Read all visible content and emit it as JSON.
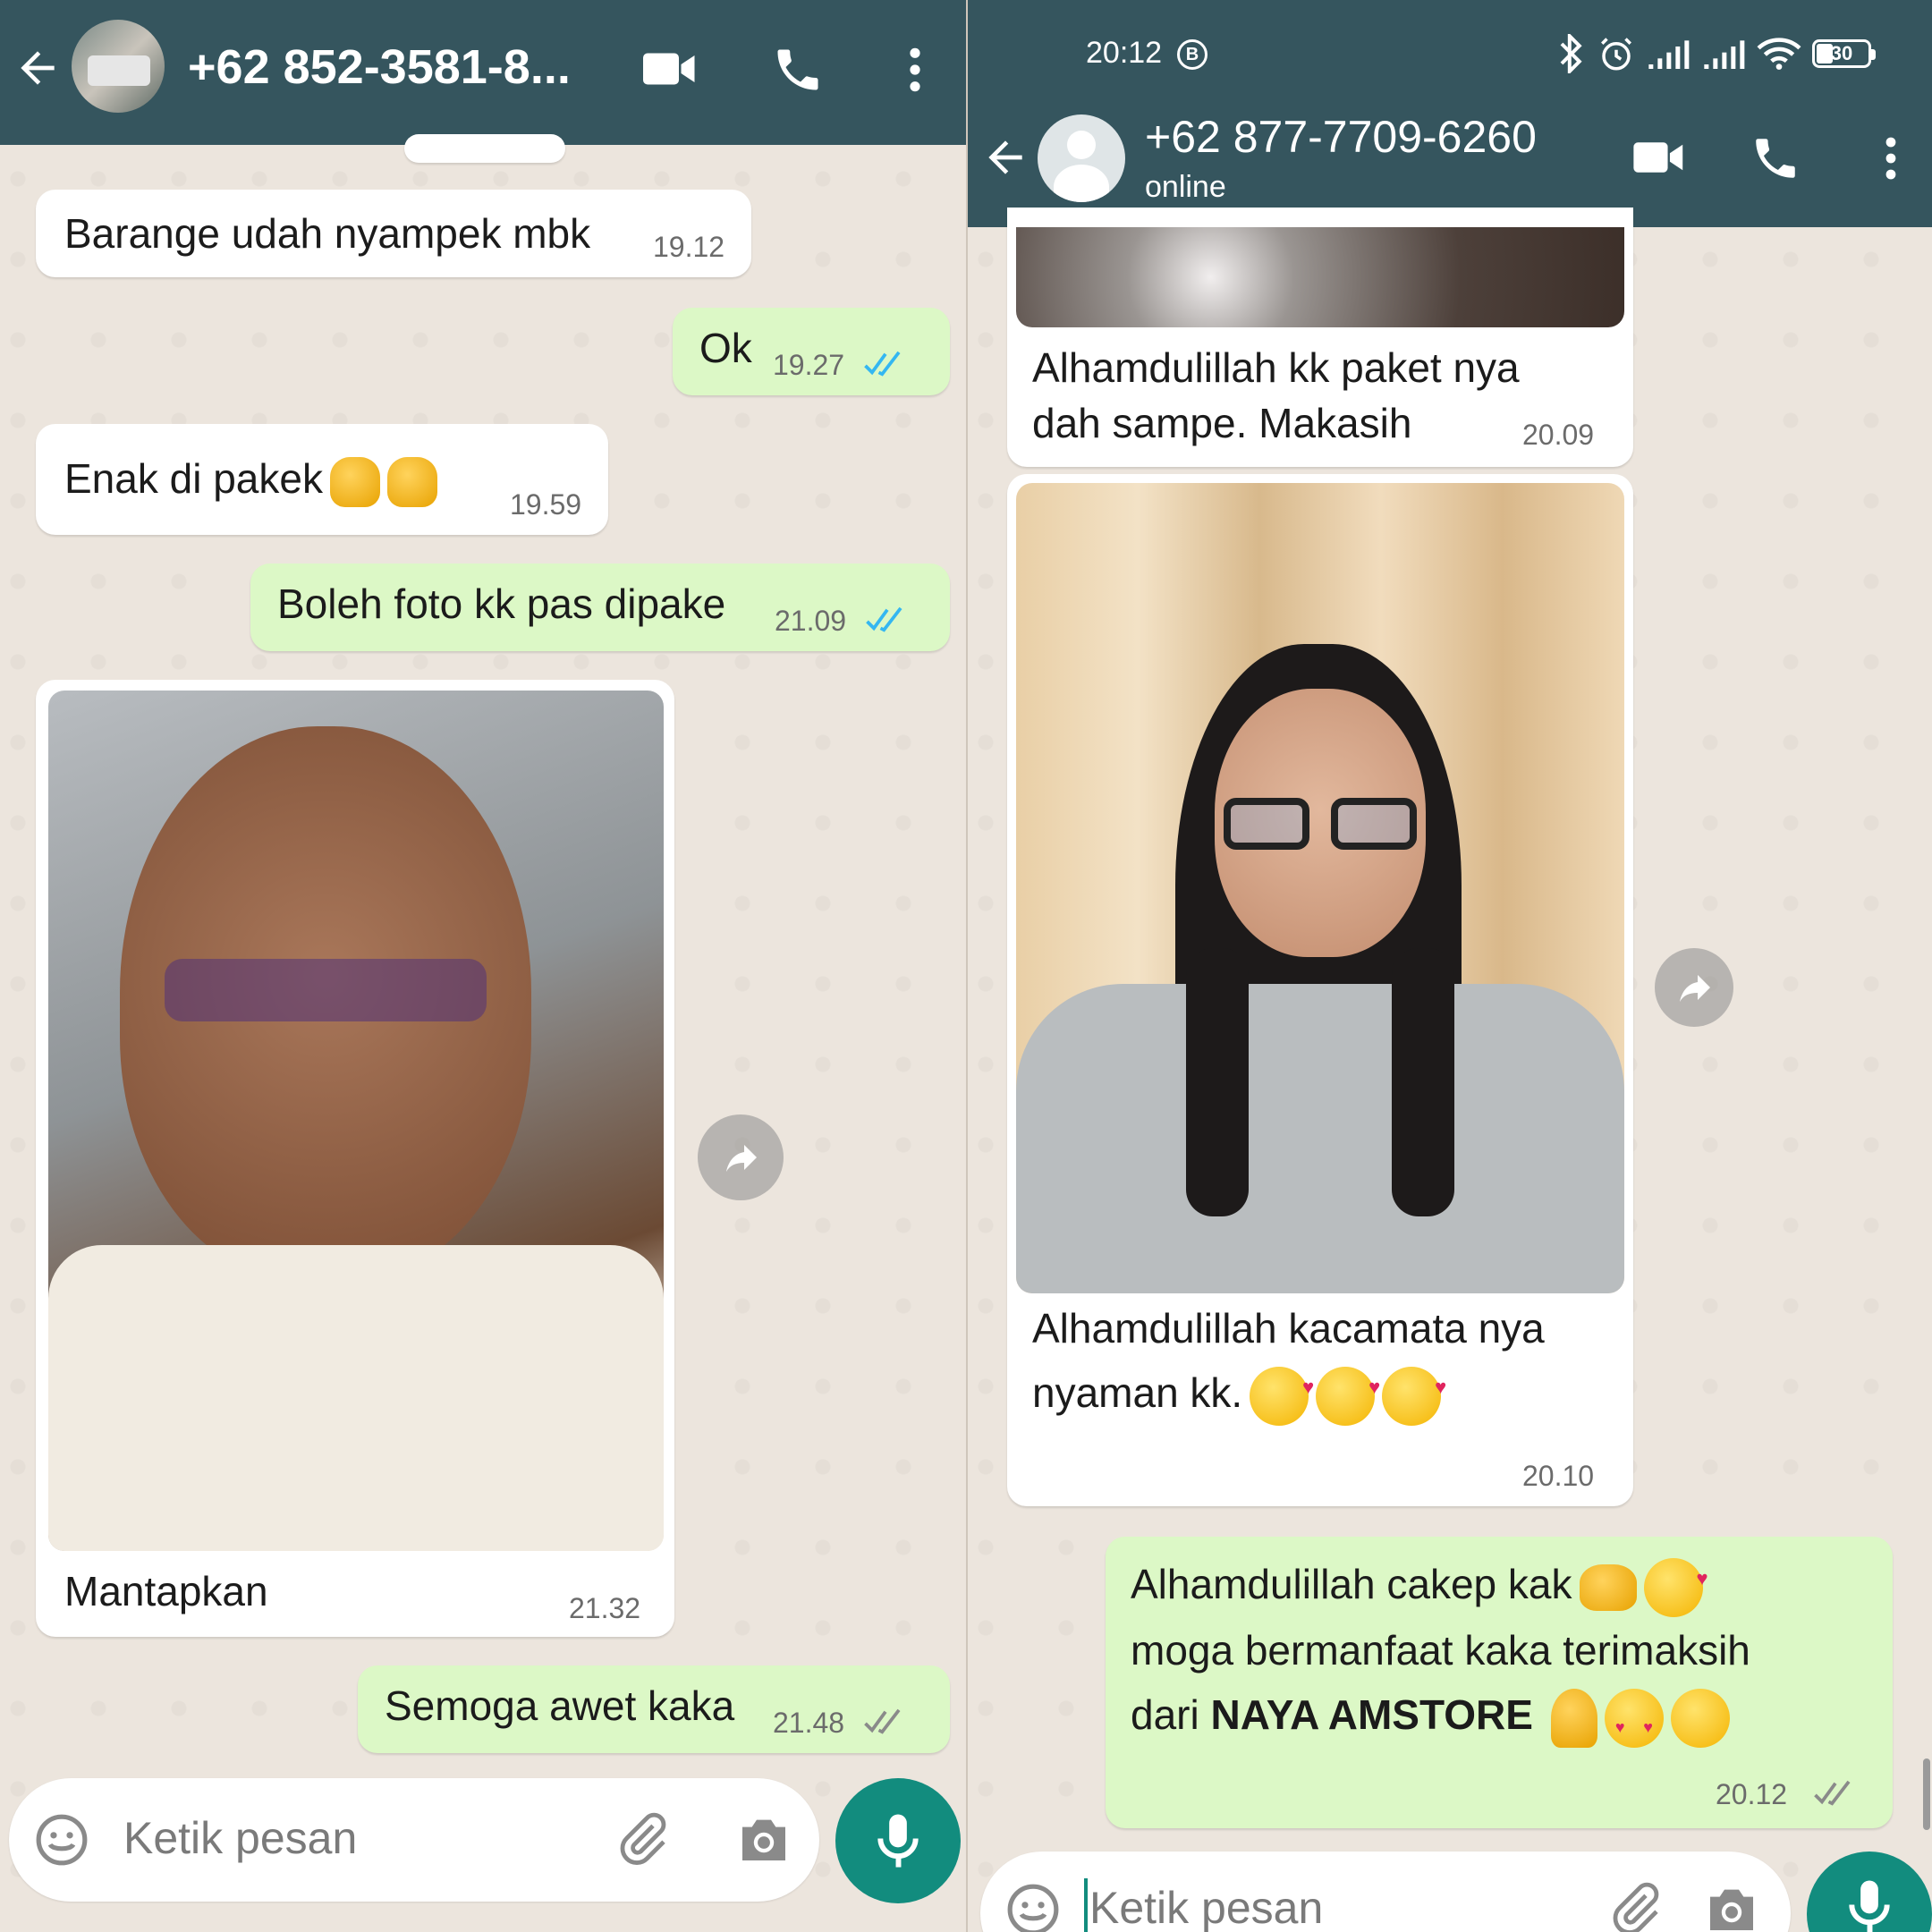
{
  "left_chat": {
    "contact_name": "+62 852-3581-8...",
    "messages": [
      {
        "text": "Barange udah nyampek mbk",
        "time": "19.12"
      },
      {
        "text": "Ok",
        "time": "19.27"
      },
      {
        "text": "Enak di pakek",
        "time": "19.59"
      },
      {
        "text": "Boleh foto kk pas dipake",
        "time": "21.09"
      },
      {
        "text": "Mantapkan",
        "time": "21.32"
      },
      {
        "text": "Semoga awet kaka",
        "time": "21.48"
      }
    ],
    "input_placeholder": "Ketik pesan"
  },
  "right_chat": {
    "status_time": "20:12",
    "battery": "30",
    "contact_name": "+62 877-7709-6260",
    "contact_status": "online",
    "messages": [
      {
        "line1": "Alhamdulillah kk paket nya",
        "line2": "dah sampe. Makasih",
        "time": "20.09"
      },
      {
        "line1": "Alhamdulillah kacamata nya",
        "line2": "nyaman kk.",
        "time": "20.10"
      },
      {
        "line1": "Alhamdulillah cakep kak",
        "line2": "moga bermanfaat kaka terimaksih",
        "line3_prefix": "dari ",
        "line3_bold": "NAYA AMSTORE",
        "time": "20.12"
      }
    ],
    "input_placeholder": "Ketik pesan"
  },
  "colors": {
    "header": "#35555e",
    "wallpaper": "#ECE5DD",
    "outgoing_bubble": "#dcf8c6",
    "incoming_bubble": "#ffffff",
    "mic_button": "#128c7e",
    "read_ticks": "#34b7f1"
  },
  "icons": [
    "back-arrow-icon",
    "video-call-icon",
    "voice-call-icon",
    "more-vert-icon",
    "emoji-icon",
    "attach-icon",
    "camera-icon",
    "mic-icon",
    "forward-icon",
    "bluetooth-icon",
    "alarm-icon",
    "signal-icon",
    "wifi-icon",
    "battery-icon",
    "double-tick-icon"
  ]
}
